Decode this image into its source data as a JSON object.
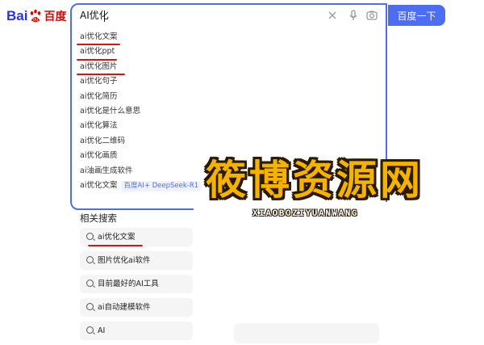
{
  "logo": {
    "bai": "Bai",
    "paw": "paw-icon",
    "du": "百度"
  },
  "search": {
    "value": "AI优化",
    "button_label": "百度一下",
    "icons": [
      "close-icon",
      "microphone-icon",
      "camera-icon"
    ]
  },
  "suggestions": [
    {
      "text": "ai优化文案",
      "underlined": true
    },
    {
      "text": "ai优化ppt",
      "underlined": true
    },
    {
      "text": "ai优化图片",
      "underlined": true
    },
    {
      "text": "ai优化句子"
    },
    {
      "text": "ai优化简历"
    },
    {
      "text": "ai优化是什么意思"
    },
    {
      "text": "ai优化算法"
    },
    {
      "text": "ai优化二维码"
    },
    {
      "text": "ai优化画质"
    },
    {
      "text": "ai油画生成软件"
    },
    {
      "text": "ai优化文案",
      "badge": "百度AI+ DeepSeek-R1"
    }
  ],
  "related": {
    "title": "相关搜索",
    "items": [
      "ai优化文案",
      "图片优化ai软件",
      "目前最好的AI工具",
      "ai自动建模软件",
      "AI"
    ]
  },
  "watermark": {
    "cn": "筱博资源网",
    "en": "XIAOBOZIYUANWANG"
  },
  "colors": {
    "accent": "#4e6ef2",
    "underline": "#cc1a1a",
    "watermark": "#f5b300"
  }
}
